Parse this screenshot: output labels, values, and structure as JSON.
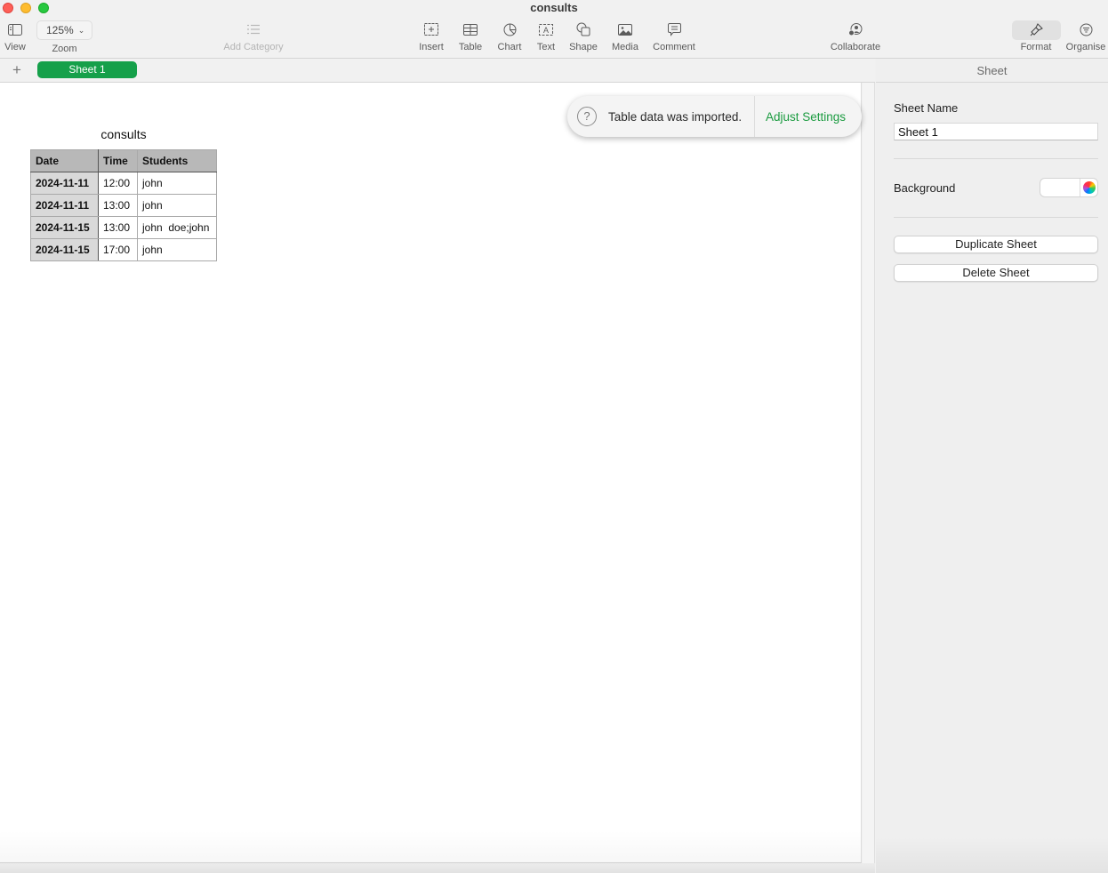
{
  "window": {
    "title": "consults"
  },
  "toolbar": {
    "view_label": "View",
    "zoom_value": "125%",
    "zoom_label": "Zoom",
    "add_category_label": "Add Category",
    "insert_label": "Insert",
    "table_label": "Table",
    "chart_label": "Chart",
    "text_label": "Text",
    "shape_label": "Shape",
    "media_label": "Media",
    "comment_label": "Comment",
    "collaborate_label": "Collaborate",
    "format_label": "Format",
    "organise_label": "Organise"
  },
  "sheets": {
    "add_symbol": "+",
    "tabs": [
      {
        "label": "Sheet 1",
        "active": true
      }
    ]
  },
  "table": {
    "title": "consults",
    "headers": [
      "Date",
      "Time",
      "Students"
    ],
    "rows": [
      [
        "2024-11-11",
        "12:00",
        "john"
      ],
      [
        "2024-11-11",
        "13:00",
        "john"
      ],
      [
        "2024-11-15",
        "13:00",
        "john  doe;john"
      ],
      [
        "2024-11-15",
        "17:00",
        "john"
      ]
    ]
  },
  "notification": {
    "icon": "question-icon",
    "icon_glyph": "?",
    "message": "Table data was imported.",
    "action_label": "Adjust Settings",
    "action_color": "#1b9b40"
  },
  "sidebar": {
    "header": "Sheet",
    "sheet_name_label": "Sheet Name",
    "sheet_name_value": "Sheet 1",
    "background_label": "Background",
    "background_color": "#ffffff",
    "duplicate_label": "Duplicate Sheet",
    "delete_label": "Delete Sheet"
  },
  "colors": {
    "accent_green": "#15a04a",
    "close": "#fe5f57",
    "minimize": "#febc2e",
    "maximize": "#28c840"
  }
}
